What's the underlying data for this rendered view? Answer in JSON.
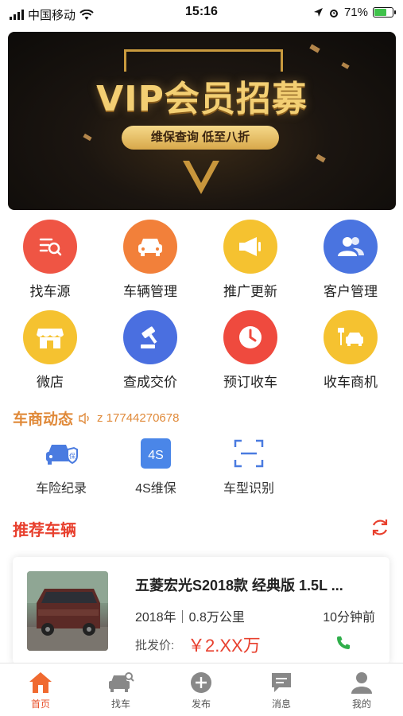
{
  "status_bar": {
    "carrier": "中国移动",
    "time": "15:16",
    "battery": "71%",
    "battery_level": 0.71
  },
  "banner": {
    "title": "VIP会员招募",
    "subtitle": "维保查询 低至八折",
    "slide_count": 4,
    "active_slide": 4
  },
  "grid": {
    "items": [
      {
        "label": "找车源",
        "icon": "search-list-icon",
        "color": "#ef5544"
      },
      {
        "label": "车辆管理",
        "icon": "car-icon",
        "color": "#f2803a"
      },
      {
        "label": "推广更新",
        "icon": "megaphone-icon",
        "color": "#f5c230"
      },
      {
        "label": "客户管理",
        "icon": "users-icon",
        "color": "#4a74e0"
      },
      {
        "label": "微店",
        "icon": "shop-icon",
        "color": "#f5c230"
      },
      {
        "label": "查成交价",
        "icon": "gavel-icon",
        "color": "#4a6fe0"
      },
      {
        "label": "预订收车",
        "icon": "clock-icon",
        "color": "#ef4a3e"
      },
      {
        "label": "收车商机",
        "icon": "car-sign-icon",
        "color": "#f5c230"
      }
    ]
  },
  "dynamics": {
    "title": "车商动态",
    "phone": "z 17744270678"
  },
  "tools": {
    "items": [
      {
        "label": "车险纪录",
        "icon": "car-insurance-icon"
      },
      {
        "label": "4S维保",
        "icon": "4s-icon",
        "badge": "4S"
      },
      {
        "label": "车型识别",
        "icon": "scan-icon"
      }
    ]
  },
  "recommended": {
    "title": "推荐车辆",
    "vehicle": {
      "name": "五菱宏光S2018款 经典版 1.5L ...",
      "meta": "2018年｜0.8万公里",
      "time": "10分钟前",
      "price_label": "批发价:",
      "price": "￥2.XX万"
    }
  },
  "tabbar": {
    "tabs": [
      {
        "label": "首页",
        "icon": "home-icon",
        "active": true
      },
      {
        "label": "找车",
        "icon": "find-car-icon",
        "active": false
      },
      {
        "label": "发布",
        "icon": "plus-circle-icon",
        "active": false
      },
      {
        "label": "消息",
        "icon": "message-icon",
        "active": false
      },
      {
        "label": "我的",
        "icon": "profile-icon",
        "active": false
      }
    ]
  },
  "colors": {
    "accent_red": "#e8402e",
    "accent_orange": "#e08a3a",
    "gold": "#f3cf73"
  }
}
